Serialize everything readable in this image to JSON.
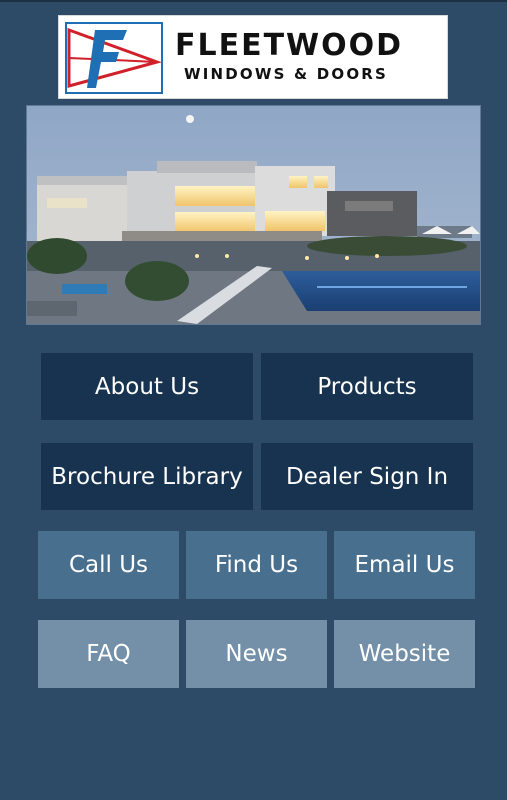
{
  "logo": {
    "title": "FLEETWOOD",
    "subtitle": "WINDOWS & DOORS",
    "mark_letter": "F"
  },
  "buttons": {
    "about": "About Us",
    "products": "Products",
    "brochure": "Brochure Library",
    "dealer": "Dealer Sign In",
    "call": "Call Us",
    "find": "Find Us",
    "email": "Email Us",
    "faq": "FAQ",
    "news": "News",
    "website": "Website"
  },
  "colors": {
    "background": "#2d4b66",
    "primary_button": "#17334f",
    "secondary_button": "#486f8e",
    "tertiary_button": "#7390a8",
    "logo_red": "#d0202a",
    "logo_blue": "#1f6fb4"
  }
}
